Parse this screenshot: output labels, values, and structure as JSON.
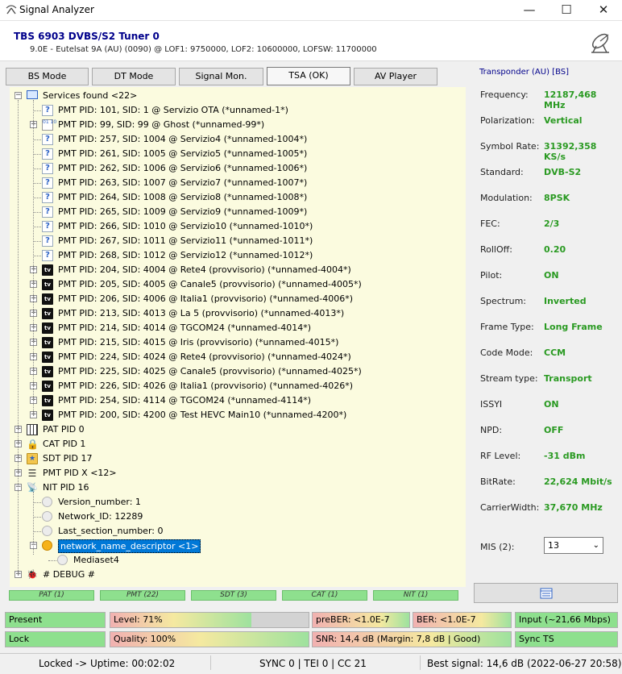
{
  "window": {
    "title": "Signal Analyzer",
    "minimize": "—",
    "maximize": "☐",
    "close": "✕"
  },
  "header": {
    "tuner": "TBS 6903 DVBS/S2 Tuner 0",
    "sat_info": "9.0E - Eutelsat 9A (AU) (0090) @ LOF1: 9750000, LOF2: 10600000, LOFSW: 11700000"
  },
  "tabs": [
    {
      "label": "BS Mode",
      "active": false
    },
    {
      "label": "DT Mode",
      "active": false
    },
    {
      "label": "Signal Mon.",
      "active": false
    },
    {
      "label": "TSA (OK)",
      "active": true
    },
    {
      "label": "AV Player",
      "active": false
    }
  ],
  "tree": {
    "root": "Services found <22>",
    "services": [
      {
        "label": "PMT PID: 101, SID: 1 @ Servizio OTA (*unnamed-1*)",
        "icon": "question-icon",
        "expandable": false
      },
      {
        "label": "PMT PID: 99, SID: 99 @ Ghost (*unnamed-99*)",
        "icon": "data-icon",
        "expandable": true
      },
      {
        "label": "PMT PID: 257, SID: 1004 @ Servizio4 (*unnamed-1004*)",
        "icon": "question-icon",
        "expandable": false
      },
      {
        "label": "PMT PID: 261, SID: 1005 @ Servizio5 (*unnamed-1005*)",
        "icon": "question-icon",
        "expandable": false
      },
      {
        "label": "PMT PID: 262, SID: 1006 @ Servizio6 (*unnamed-1006*)",
        "icon": "question-icon",
        "expandable": false
      },
      {
        "label": "PMT PID: 263, SID: 1007 @ Servizio7 (*unnamed-1007*)",
        "icon": "question-icon",
        "expandable": false
      },
      {
        "label": "PMT PID: 264, SID: 1008 @ Servizio8 (*unnamed-1008*)",
        "icon": "question-icon",
        "expandable": false
      },
      {
        "label": "PMT PID: 265, SID: 1009 @ Servizio9 (*unnamed-1009*)",
        "icon": "question-icon",
        "expandable": false
      },
      {
        "label": "PMT PID: 266, SID: 1010 @ Servizio10 (*unnamed-1010*)",
        "icon": "question-icon",
        "expandable": false
      },
      {
        "label": "PMT PID: 267, SID: 1011 @ Servizio11 (*unnamed-1011*)",
        "icon": "question-icon",
        "expandable": false
      },
      {
        "label": "PMT PID: 268, SID: 1012 @ Servizio12 (*unnamed-1012*)",
        "icon": "question-icon",
        "expandable": false
      },
      {
        "label": "PMT PID: 204, SID: 4004 @ Rete4 (provvisorio) (*unnamed-4004*)",
        "icon": "tv-icon",
        "expandable": true
      },
      {
        "label": "PMT PID: 205, SID: 4005 @ Canale5 (provvisorio) (*unnamed-4005*)",
        "icon": "tv-icon",
        "expandable": true
      },
      {
        "label": "PMT PID: 206, SID: 4006 @ Italia1 (provvisorio) (*unnamed-4006*)",
        "icon": "tv-icon",
        "expandable": true
      },
      {
        "label": "PMT PID: 213, SID: 4013 @ La 5 (provvisorio) (*unnamed-4013*)",
        "icon": "tv-icon",
        "expandable": true
      },
      {
        "label": "PMT PID: 214, SID: 4014 @ TGCOM24 (*unnamed-4014*)",
        "icon": "tv-icon",
        "expandable": true
      },
      {
        "label": "PMT PID: 215, SID: 4015 @ Iris (provvisorio) (*unnamed-4015*)",
        "icon": "tv-icon",
        "expandable": true
      },
      {
        "label": "PMT PID: 224, SID: 4024 @ Rete4 (provvisorio) (*unnamed-4024*)",
        "icon": "tv-icon",
        "expandable": true
      },
      {
        "label": "PMT PID: 225, SID: 4025 @ Canale5 (provvisorio) (*unnamed-4025*)",
        "icon": "tv-icon",
        "expandable": true
      },
      {
        "label": "PMT PID: 226, SID: 4026 @ Italia1 (provvisorio) (*unnamed-4026*)",
        "icon": "tv-icon",
        "expandable": true
      },
      {
        "label": "PMT PID: 254, SID: 4114 @ TGCOM24 (*unnamed-4114*)",
        "icon": "tv-icon",
        "expandable": true
      },
      {
        "label": "PMT PID: 200, SID: 4200 @ Test HEVC Main10 (*unnamed-4200*)",
        "icon": "tv-icon",
        "expandable": true
      }
    ],
    "tables": [
      {
        "label": "PAT PID 0",
        "icon": "grid-icon"
      },
      {
        "label": "CAT PID 1",
        "icon": "lock-icon"
      },
      {
        "label": "SDT PID 17",
        "icon": "folder-star-icon"
      },
      {
        "label": "PMT PID X <12>",
        "icon": "list-icon"
      }
    ],
    "nit": {
      "label": "NIT PID 16",
      "children": [
        "Version_number: 1",
        "Network_ID: 12289",
        "Last_section_number: 0"
      ],
      "descriptor": "network_name_descriptor <1>",
      "descriptor_child": "Mediaset4"
    },
    "debug": "# DEBUG #"
  },
  "strips": [
    "PAT (1)",
    "PMT (22)",
    "SDT (3)",
    "CAT (1)",
    "NIT (1)"
  ],
  "transponder": {
    "title": "Transponder (AU) [BS]",
    "rows": [
      {
        "label": "Frequency:",
        "value": "12187,468 MHz"
      },
      {
        "label": "Polarization:",
        "value": "Vertical"
      },
      {
        "label": "Symbol Rate:",
        "value": "31392,358 KS/s"
      },
      {
        "label": "Standard:",
        "value": "DVB-S2"
      },
      {
        "label": "Modulation:",
        "value": "8PSK"
      },
      {
        "label": "FEC:",
        "value": "2/3"
      },
      {
        "label": "RollOff:",
        "value": "0.20"
      },
      {
        "label": "Pilot:",
        "value": "ON"
      },
      {
        "label": "Spectrum:",
        "value": "Inverted"
      },
      {
        "label": "Frame Type:",
        "value": "Long Frame"
      },
      {
        "label": "Code Mode:",
        "value": "CCM"
      },
      {
        "label": "Stream type:",
        "value": "Transport"
      },
      {
        "label": "ISSYI",
        "value": "ON"
      },
      {
        "label": "NPD:",
        "value": "OFF"
      },
      {
        "label": "RF Level:",
        "value": "-31 dBm"
      },
      {
        "label": "BitRate:",
        "value": "22,624 Mbit/s"
      },
      {
        "label": "CarrierWidth:",
        "value": "37,670 MHz"
      }
    ],
    "mis_label": "MIS (2):",
    "mis_value": "13"
  },
  "meters": {
    "present": "Present",
    "level": "Level: 71%",
    "level_fraction": 0.71,
    "preber": "preBER: <1.0E-7",
    "ber": "BER: <1.0E-7",
    "input": "Input (~21,66 Mbps)",
    "lock": "Lock",
    "quality": "Quality: 100%",
    "quality_fraction": 1.0,
    "snr": "SNR: 14,4 dB (Margin: 7,8 dB | Good)",
    "sync": "Sync TS"
  },
  "status": {
    "locked": "Locked -> Uptime: 00:02:02",
    "sync": "SYNC 0 | TEI 0 | CC 21",
    "best": "Best signal: 14,6 dB (2022-06-27 20:58)"
  },
  "colors": {
    "good_green": "#2a9a22",
    "meter_green": "#8ee08e",
    "tuner_blue": "#00008b",
    "selection": "#0078d7"
  }
}
